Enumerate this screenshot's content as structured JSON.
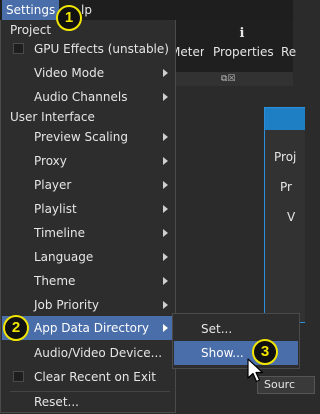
{
  "menubar": {
    "settings_label": "Settings",
    "help_label": "lp"
  },
  "toolbar": {
    "meter_label": "Meter",
    "properties_label": "Properties",
    "recent_label": "Re"
  },
  "properties_panel": {
    "labels": [
      "Proj",
      "Pr",
      "V"
    ]
  },
  "bottom_tab_label": "Sourc",
  "settings_menu": {
    "project_section": "Project",
    "gpu_effects": "GPU Effects (unstable)",
    "video_mode": "Video Mode",
    "audio_channels": "Audio Channels",
    "user_interface_section": "User Interface",
    "preview_scaling": "Preview Scaling",
    "proxy": "Proxy",
    "player": "Player",
    "playlist": "Playlist",
    "timeline": "Timeline",
    "language": "Language",
    "theme": "Theme",
    "job_priority": "Job Priority",
    "app_data_directory": "App Data Directory",
    "audio_video_device": "Audio/Video Device...",
    "clear_recent_on_exit": "Clear Recent on Exit",
    "reset": "Reset..."
  },
  "app_data_submenu": {
    "set": "Set...",
    "show": "Show..."
  },
  "badges": {
    "one": "1",
    "two": "2",
    "three": "3"
  },
  "colors": {
    "highlight": "#4a6ea9",
    "badge_yellow": "#f2e600",
    "panel_accent": "#1f7fc4"
  },
  "icons": {
    "properties": "info-icon",
    "float_panel": "float-panel-icon",
    "submenu_arrow": "chevron-right-icon",
    "cursor": "mouse-pointer-icon"
  }
}
